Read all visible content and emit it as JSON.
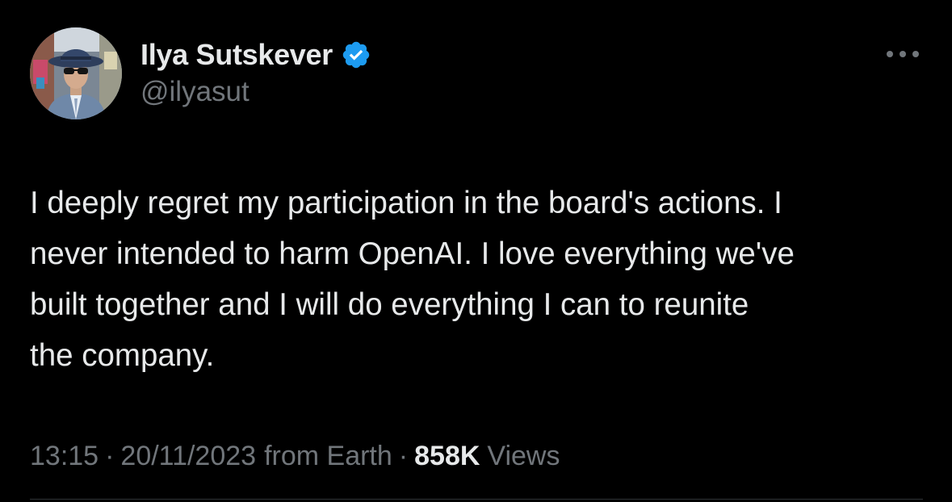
{
  "author": {
    "display_name": "Ilya Sutskever",
    "handle": "@ilyasut",
    "verified": true
  },
  "tweet": {
    "text_lines": [
      "I deeply regret my participation in the board's actions. I",
      "never intended to harm OpenAI. I love everything we've",
      "built together and I will do everything I can to reunite",
      "the company."
    ]
  },
  "meta": {
    "time": "13:15",
    "separator": "·",
    "date": "20/11/2023",
    "source": "from Earth",
    "views_count": "858K",
    "views_label": "Views"
  },
  "icons": {
    "verified": "verified-badge-icon",
    "more": "more-options-icon",
    "avatar": "avatar-photo"
  },
  "colors": {
    "background": "#000000",
    "primary_text": "#e7e9ea",
    "secondary_text": "#71767b",
    "verified_blue": "#1d9bf0",
    "divider": "#2f3336"
  }
}
